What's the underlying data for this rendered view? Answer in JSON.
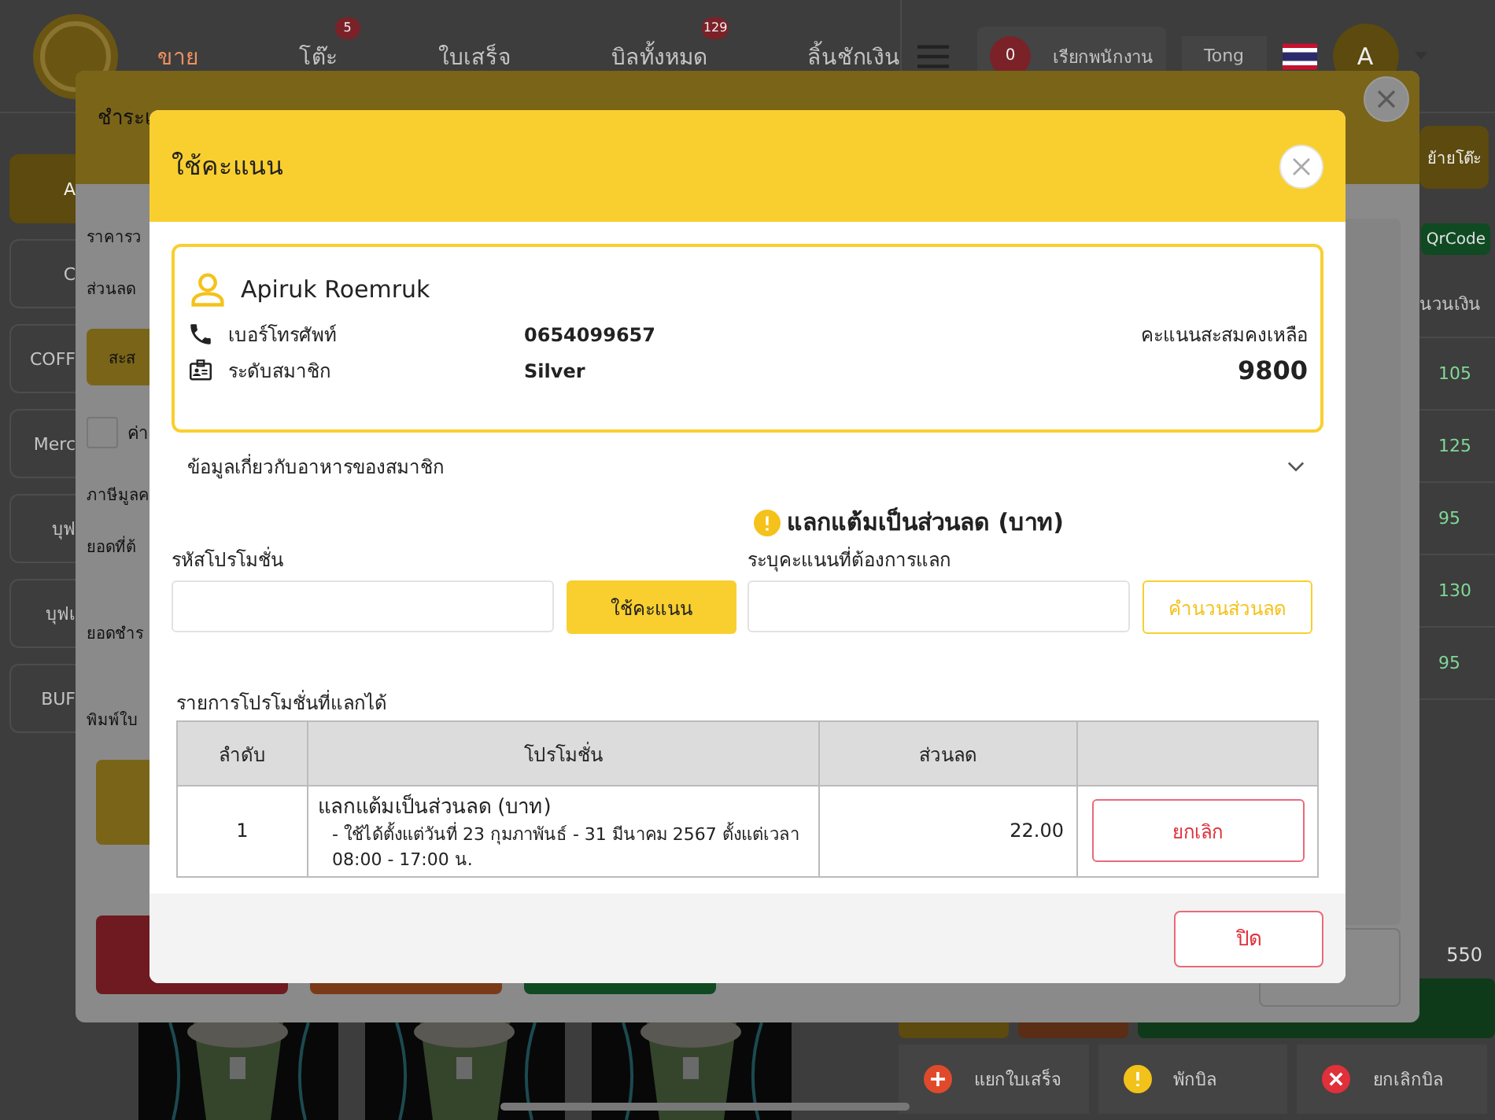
{
  "top_bar": {
    "nav": [
      {
        "label": "ขาย",
        "selected": true
      },
      {
        "label": "โต๊ะ",
        "selected": false,
        "badge": "5"
      },
      {
        "label": "ใบเสร็จ",
        "selected": false
      },
      {
        "label": "บิลทั้งหมด",
        "selected": false,
        "badge": "129"
      },
      {
        "label": "ลิ้นชักเงิน",
        "selected": false
      }
    ],
    "call_count": "0",
    "call_staff": "เรียกพนักงาน",
    "user_name": "Tong",
    "avatar": "A"
  },
  "categories": [
    {
      "label": "A",
      "selected": true
    },
    {
      "label": "C",
      "selected": false
    },
    {
      "label": "COFF",
      "selected": false
    },
    {
      "label": "Merc",
      "selected": false
    },
    {
      "label": "บุฟ",
      "selected": false
    },
    {
      "label": "บุฟเ",
      "selected": false
    },
    {
      "label": "BUF",
      "selected": false
    }
  ],
  "order_panel": {
    "move_table": "ย้ายโต๊ะ",
    "qrcode": "QrCode",
    "amount_header": "นวนเงิน",
    "amounts": [
      "105",
      "125",
      "95",
      "130",
      "95"
    ],
    "total": "550",
    "actions": [
      {
        "label": "แยกใบเสร็จ",
        "kind": "add"
      },
      {
        "label": "พักบิล",
        "kind": "hold"
      },
      {
        "label": "ยกเลิกบิล",
        "kind": "cancel"
      }
    ]
  },
  "payment_dialog": {
    "title": "ชำระเ",
    "subtotal": "ราคารว",
    "discount": "ส่วนลด",
    "points_button": "สะส",
    "service_charge": {
      "label": "ค่า",
      "checked": false
    },
    "vat": "ภาษีมูลค",
    "due": "ยอดที่ต้",
    "paid": "ยอดชำร",
    "print": "พิมพ์ใบ"
  },
  "points_dialog": {
    "title": "ใช้คะแนน",
    "member": {
      "name": "Apiruk Roemruk",
      "phone_label": "เบอร์โทรศัพท์",
      "phone": "0654099657",
      "level_label": "ระดับสมาชิก",
      "level": "Silver",
      "points_label": "คะแนนสะสมคงเหลือ",
      "points": "9800"
    },
    "food_info": {
      "label": "ข้อมูลเกี่ยวกับอาหารของสมาชิก",
      "expanded": false
    },
    "promo_code": {
      "label": "รหัสโปรโมชั่น",
      "button": "ใช้คะแนน"
    },
    "redeem": {
      "heading": "แลกแต้มเป็นส่วนลด (บาท)",
      "label": "ระบุคะแนนที่ต้องการแลก",
      "button": "คำนวนส่วนลด"
    },
    "table": {
      "title": "รายการโปรโมชั่นที่แลกได้",
      "columns": [
        "ลำดับ",
        "โปรโมชั่น",
        "ส่วนลด"
      ],
      "rows": [
        {
          "no": "1",
          "promotion": "แลกแต้มเป็นส่วนลด (บาท)",
          "detail": "- ใช้ได้ตั้งแต่วันที่ 23 กุมภาพันธ์ - 31 มีนาคม 2567  ตั้งแต่เวลา 08:00 - 17:00 น.",
          "discount": "22.00",
          "action": "ยกเลิก"
        }
      ]
    },
    "close": "ปิด"
  }
}
